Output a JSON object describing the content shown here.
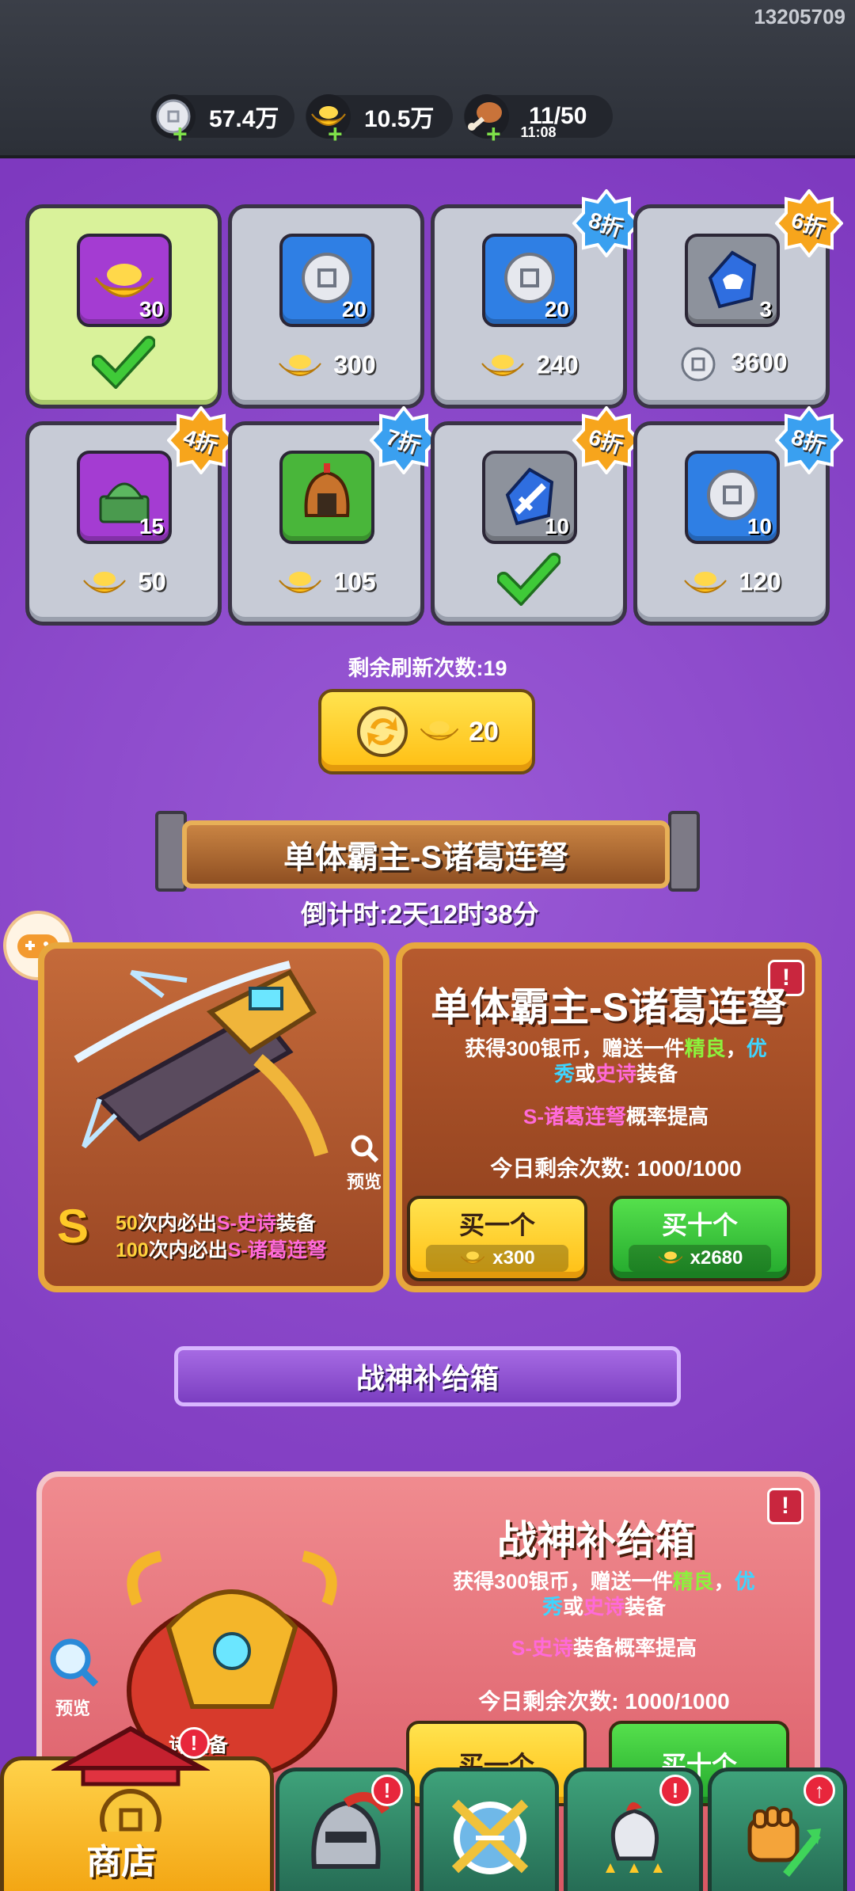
{
  "header": {
    "uid": "13205709",
    "resources": [
      {
        "name": "silver",
        "value": "57.4万",
        "icon": "silver-coin-icon"
      },
      {
        "name": "gold",
        "value": "10.5万",
        "icon": "gold-ingot-icon"
      },
      {
        "name": "stamina",
        "value": "11/50",
        "sub": "11:08",
        "icon": "drumstick-icon"
      }
    ]
  },
  "shop": {
    "items": [
      {
        "qty": "30",
        "color": "purple",
        "icon": "gold-ingot-icon",
        "price": "",
        "sold": true,
        "discount": ""
      },
      {
        "qty": "20",
        "color": "blue",
        "icon": "silver-coin-icon",
        "price": "300",
        "currency": "gold",
        "sold": false,
        "discount": ""
      },
      {
        "qty": "20",
        "color": "blue",
        "icon": "silver-coin-icon",
        "price": "240",
        "currency": "gold",
        "sold": false,
        "discount": "8折"
      },
      {
        "qty": "3",
        "color": "gray",
        "icon": "helmet-shard-icon",
        "price": "3600",
        "currency": "silver",
        "sold": false,
        "discount": "6折"
      },
      {
        "qty": "15",
        "color": "purple",
        "icon": "jade-seal-icon",
        "price": "50",
        "currency": "gold",
        "sold": false,
        "discount": "4折"
      },
      {
        "qty": "",
        "color": "green",
        "icon": "warrior-helmet-icon",
        "price": "105",
        "currency": "gold",
        "sold": false,
        "discount": "7折"
      },
      {
        "qty": "10",
        "color": "gray",
        "icon": "sword-shard-icon",
        "price": "",
        "sold": true,
        "discount": "6折"
      },
      {
        "qty": "10",
        "color": "blue",
        "icon": "silver-coin-icon",
        "price": "120",
        "currency": "gold",
        "sold": false,
        "discount": "8折"
      }
    ],
    "refresh_text": "剩余刷新次数:19",
    "refresh_cost": "20"
  },
  "event1": {
    "banner": "单体霸主-S诸葛连弩",
    "countdown": "倒计时:2天12时38分",
    "title": "单体霸主-S诸葛连弩",
    "desc_a": "获得300银币，赠送一件",
    "desc_b": "精良",
    "desc_c": "，",
    "desc_d": "优",
    "desc_e": "秀",
    "desc_f": "或",
    "desc_g": "史诗",
    "desc_h": "装备",
    "rate_a": "S-诸葛连弩",
    "rate_b": "概率提高",
    "remaining": "今日剩余次数:  1000/1000",
    "preview": "预览",
    "grade": "S",
    "g1a": "50",
    "g1b": "次内必出",
    "g1c": "S-史诗",
    "g1d": "装备",
    "g2a": "100",
    "g2b": "次内必出",
    "g2c": "S-诸葛连弩",
    "buy_one": "买一个",
    "buy_one_cost": "x300",
    "buy_ten": "买十个",
    "buy_ten_cost": "x2680",
    "alert": "!"
  },
  "event2": {
    "banner": "战神补给箱",
    "title": "战神补给箱",
    "desc_a": "获得300银币，赠送一件",
    "desc_b": "精良",
    "desc_c": "，",
    "desc_d": "优",
    "desc_e": "秀",
    "desc_f": "或",
    "desc_g": "史诗",
    "desc_h": "装备",
    "rate_a": "S-史诗",
    "rate_b": "装备概率提高",
    "remaining": "今日剩余次数:  1000/1000",
    "preview": "预览",
    "partial": "诗装备",
    "buy_one": "买一个",
    "buy_ten": "买十个",
    "alert": "!"
  },
  "nav": {
    "shop_label": "商店",
    "alert": "!",
    "tabs": [
      {
        "icon": "knight-helmet-icon",
        "badge": "!"
      },
      {
        "icon": "crossed-swords-shield-icon",
        "badge": ""
      },
      {
        "icon": "rooster-stars-icon",
        "badge": "!"
      },
      {
        "icon": "fist-upgrade-icon",
        "badge": "↑"
      }
    ]
  }
}
